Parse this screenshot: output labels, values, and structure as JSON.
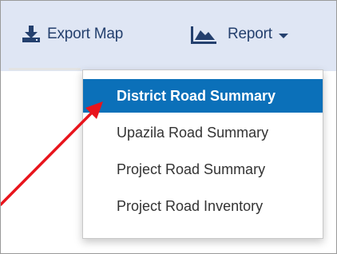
{
  "toolbar": {
    "export_map": {
      "label": "Export Map",
      "icon": "download-icon"
    },
    "report": {
      "label": "Report",
      "icon": "area-chart-icon",
      "caret_icon": "caret-down-icon"
    }
  },
  "report_menu": {
    "items": [
      {
        "label": "District Road Summary",
        "state": "highlighted"
      },
      {
        "label": "Upazila Road Summary"
      },
      {
        "label": "Project Road Summary"
      },
      {
        "label": "Project Road Inventory"
      }
    ]
  },
  "colors": {
    "toolbar_background": "#dfe6f4",
    "toolbar_text": "#24406e",
    "highlight": "#0b70b9",
    "annotation_arrow": "#e8141c"
  }
}
